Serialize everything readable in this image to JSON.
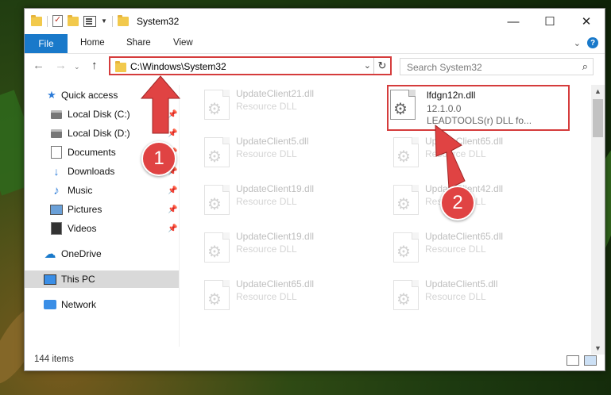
{
  "window": {
    "title": "System32",
    "controls": {
      "minimize": "—",
      "maximize": "☐",
      "close": "✕"
    }
  },
  "ribbon": {
    "tabs": [
      "File",
      "Home",
      "Share",
      "View"
    ]
  },
  "navbar": {
    "address": "C:\\Windows\\System32",
    "search_placeholder": "Search System32"
  },
  "sidebar": {
    "items": [
      {
        "label": "Quick access",
        "icon": "star-icon",
        "pinned": false
      },
      {
        "label": "Local Disk (C:)",
        "icon": "drive-icon",
        "pinned": true
      },
      {
        "label": "Local Disk (D:)",
        "icon": "drive-icon",
        "pinned": true
      },
      {
        "label": "Documents",
        "icon": "documents-icon",
        "pinned": true
      },
      {
        "label": "Downloads",
        "icon": "download-icon",
        "pinned": true
      },
      {
        "label": "Music",
        "icon": "music-icon",
        "pinned": true
      },
      {
        "label": "Pictures",
        "icon": "pictures-icon",
        "pinned": true
      },
      {
        "label": "Videos",
        "icon": "videos-icon",
        "pinned": true
      },
      {
        "label": "OneDrive",
        "icon": "cloud-icon",
        "pinned": false
      },
      {
        "label": "This PC",
        "icon": "pc-icon",
        "pinned": false,
        "selected": true
      },
      {
        "label": "Network",
        "icon": "network-icon",
        "pinned": false
      }
    ]
  },
  "files": {
    "left_column": [
      {
        "name": "UpdateClient21.dll",
        "type": "Resource DLL"
      },
      {
        "name": "UpdateClient5.dll",
        "type": "Resource DLL"
      },
      {
        "name": "UpdateClient19.dll",
        "type": "Resource DLL"
      },
      {
        "name": "UpdateClient19.dll",
        "type": "Resource DLL"
      },
      {
        "name": "UpdateClient65.dll",
        "type": "Resource DLL"
      }
    ],
    "right_column": [
      {
        "name": "UpdateClient65.dll",
        "type": "Resource DLL"
      },
      {
        "name": "UpdateClient42.dll",
        "type": "Resource DLL"
      },
      {
        "name": "UpdateClient65.dll",
        "type": "Resource DLL"
      },
      {
        "name": "UpdateClient5.dll",
        "type": "Resource DLL"
      }
    ],
    "highlighted": {
      "name": "lfdgn12n.dll",
      "version": "12.1.0.0",
      "description": "LEADTOOLS(r) DLL fo..."
    }
  },
  "status": {
    "item_count": "144 items"
  },
  "annotations": {
    "step1": "1",
    "step2": "2",
    "color": "#e04343"
  },
  "colors": {
    "accent": "#1979ca",
    "highlight_border": "#d53c3c"
  }
}
